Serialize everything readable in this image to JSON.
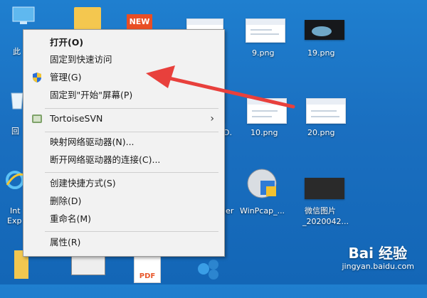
{
  "menu": {
    "items": [
      {
        "label": "打开(O)",
        "bold": true
      },
      {
        "label": "固定到快速访问"
      },
      {
        "label": "管理(G)",
        "icon": "shield-icon"
      },
      {
        "label": "固定到\"开始\"屏幕(P)"
      },
      {
        "label": "TortoiseSVN",
        "icon": "tortoisesvn-icon",
        "submenu": true
      },
      {
        "label": "映射网络驱动器(N)..."
      },
      {
        "label": "断开网络驱动器的连接(C)..."
      },
      {
        "label": "创建快捷方式(S)"
      },
      {
        "label": "删除(D)"
      },
      {
        "label": "重命名(M)"
      },
      {
        "label": "属性(R)"
      }
    ]
  },
  "desktop": {
    "icons": [
      {
        "label": "此"
      },
      {
        "label": "回"
      },
      {
        "label": "Int"
      },
      {
        "label": "Exp"
      },
      {
        "label": "9.png"
      },
      {
        "label": "19.png"
      },
      {
        "label": "10.png"
      },
      {
        "label": "20.png"
      },
      {
        "label": "ler"
      },
      {
        "label": "WinPcap_..."
      },
      {
        "label": "微信图片"
      },
      {
        "label": "_2020042..."
      },
      {
        "label": "NEW"
      },
      {
        "label": "PDF"
      },
      {
        "label": "D."
      }
    ]
  },
  "watermark": {
    "brand": "Bai 经验",
    "site": "jingyan.baidu.com"
  },
  "colors": {
    "desktop": "#1a6fc0",
    "menu_bg": "#f2f2f2",
    "arrow": "#e8403c"
  }
}
